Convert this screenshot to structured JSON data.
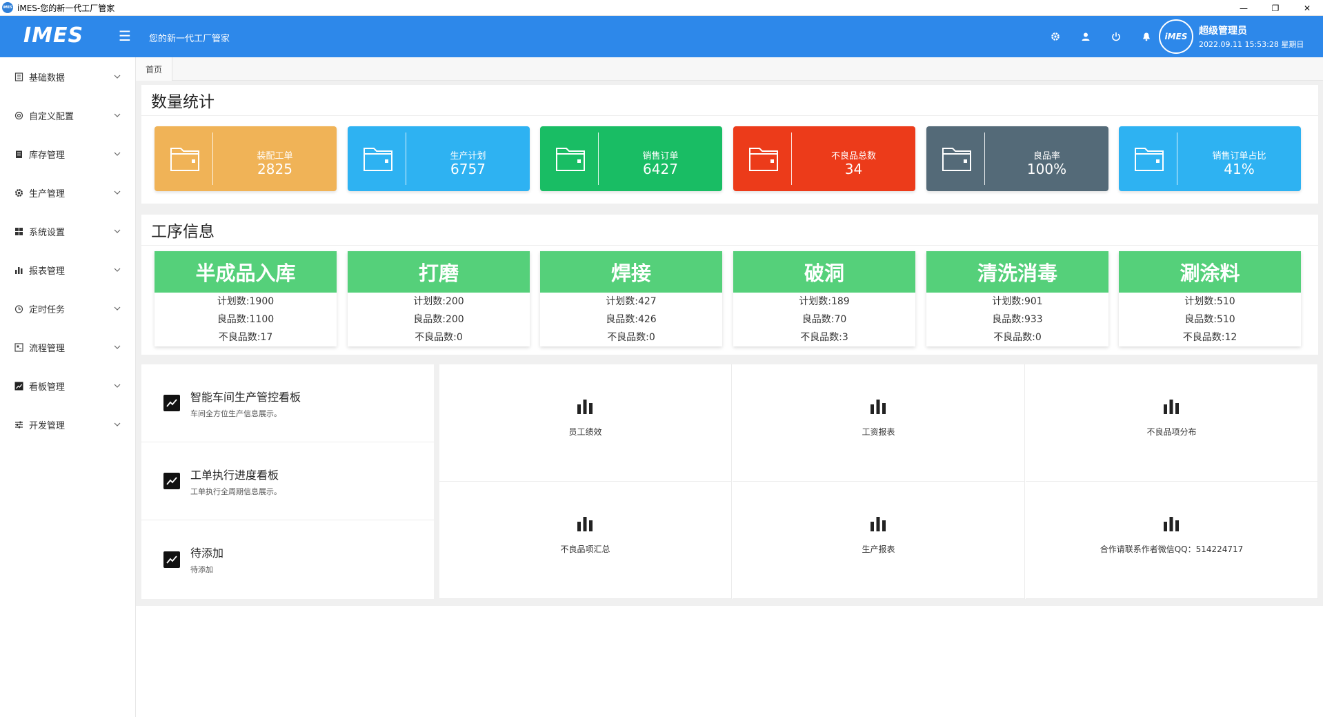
{
  "window": {
    "title": "iMES-您的新一代工厂管家",
    "app_icon_text": "iMES",
    "minimize": "—",
    "restore": "❐",
    "close": "✕"
  },
  "header": {
    "logo": "IMES",
    "slogan": "您的新一代工厂管家",
    "icons": [
      "settings-icon",
      "user-icon",
      "power-icon",
      "bell-icon"
    ],
    "avatar_text": "iMES",
    "user_name": "超级管理员",
    "datetime": "2022.09.11 15:53:28 星期日",
    "color": "#2d88ea"
  },
  "sidebar": {
    "items": [
      {
        "label": "基础数据",
        "icon": "document-icon"
      },
      {
        "label": "自定义配置",
        "icon": "gear-outline-icon"
      },
      {
        "label": "库存管理",
        "icon": "clipboard-icon"
      },
      {
        "label": "生产管理",
        "icon": "cog-icon"
      },
      {
        "label": "系统设置",
        "icon": "grid-icon"
      },
      {
        "label": "报表管理",
        "icon": "bar-chart-icon"
      },
      {
        "label": "定时任务",
        "icon": "clock-icon"
      },
      {
        "label": "流程管理",
        "icon": "flow-icon"
      },
      {
        "label": "看板管理",
        "icon": "trend-icon"
      },
      {
        "label": "开发管理",
        "icon": "sliders-icon"
      }
    ]
  },
  "tabs": {
    "home": "首页"
  },
  "stats": {
    "title": "数量统计",
    "cards": [
      {
        "label": "装配工单",
        "value": "2825",
        "color": "#f0b357"
      },
      {
        "label": "生产计划",
        "value": "6757",
        "color": "#2eb2f2"
      },
      {
        "label": "销售订单",
        "value": "6427",
        "color": "#19bd64"
      },
      {
        "label": "不良品总数",
        "value": "34",
        "color": "#ec3b1a"
      },
      {
        "label": "良品率",
        "value": "100%",
        "color": "#546a78"
      },
      {
        "label": "销售订单占比",
        "value": "41%",
        "color": "#2eb2f2"
      }
    ]
  },
  "process": {
    "title": "工序信息",
    "color": "#55d07a",
    "cards": [
      {
        "name": "半成品入库",
        "plan": "计划数:1900",
        "good": "良品数:1100",
        "bad": "不良品数:17"
      },
      {
        "name": "打磨",
        "plan": "计划数:200",
        "good": "良品数:200",
        "bad": "不良品数:0"
      },
      {
        "name": "焊接",
        "plan": "计划数:427",
        "good": "良品数:426",
        "bad": "不良品数:0"
      },
      {
        "name": "破洞",
        "plan": "计划数:189",
        "good": "良品数:70",
        "bad": "不良品数:3"
      },
      {
        "name": "清洗消毒",
        "plan": "计划数:901",
        "good": "良品数:933",
        "bad": "不良品数:0"
      },
      {
        "name": "涮涂料",
        "plan": "计划数:510",
        "good": "良品数:510",
        "bad": "不良品数:12"
      }
    ]
  },
  "boards": [
    {
      "title": "智能车间生产管控看板",
      "desc": "车间全方位生产信息展示。"
    },
    {
      "title": "工单执行进度看板",
      "desc": "工单执行全周期信息展示。"
    },
    {
      "title": "待添加",
      "desc": "待添加"
    }
  ],
  "reports": [
    {
      "label": "员工绩效"
    },
    {
      "label": "工资报表"
    },
    {
      "label": "不良品项分布"
    },
    {
      "label": "不良品项汇总"
    },
    {
      "label": "生产报表"
    },
    {
      "label": "合作请联系作者微信QQ：514224717"
    }
  ]
}
